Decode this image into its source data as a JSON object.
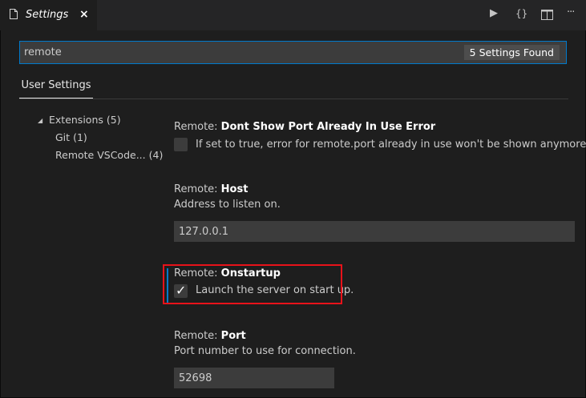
{
  "tab": {
    "title": "Settings",
    "close": "×"
  },
  "actions": {
    "run": "▶",
    "json": "{}",
    "split": "▯",
    "more": "···"
  },
  "search": {
    "value": "remote",
    "found": "5 Settings Found"
  },
  "scope": {
    "user_settings": "User Settings"
  },
  "toc": [
    {
      "label": "Extensions",
      "count": "(5)"
    },
    {
      "label": "Git",
      "count": "(1)"
    },
    {
      "label": "Remote VSCode...",
      "count": "(4)"
    }
  ],
  "settings": {
    "dont_show": {
      "category": "Remote: ",
      "key": "Dont Show Port Already In Use Error",
      "description": "If set to true, error for remote.port already in use won't be shown anymore.",
      "checked": false
    },
    "host": {
      "category": "Remote: ",
      "key": "Host",
      "description": "Address to listen on.",
      "value": "127.0.0.1"
    },
    "onstartup": {
      "category": "Remote: ",
      "key": "Onstartup",
      "description": "Launch the server on start up.",
      "checked": true
    },
    "port": {
      "category": "Remote: ",
      "key": "Port",
      "description": "Port number to use for connection.",
      "value": "52698"
    }
  },
  "colors": {
    "accent": "#007acc",
    "highlight": "#e8121a",
    "background": "#1e1e1e"
  }
}
